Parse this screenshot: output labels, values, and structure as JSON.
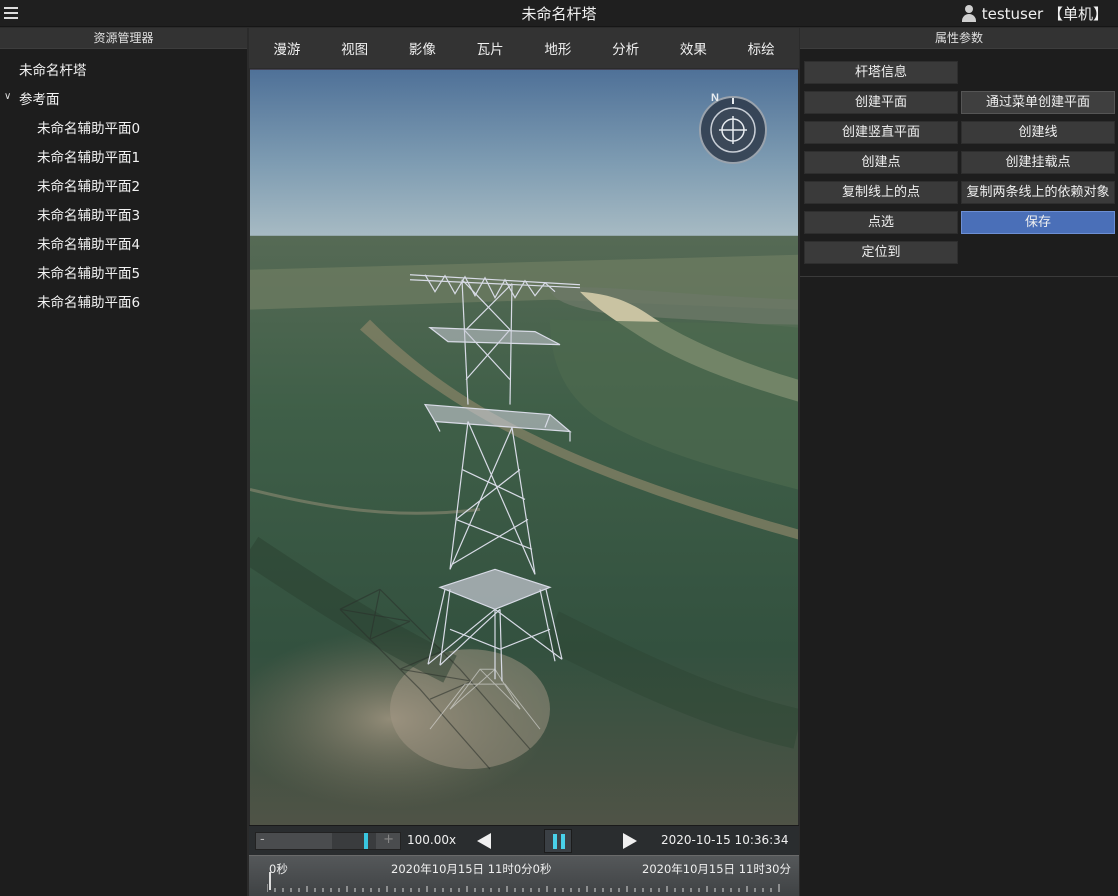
{
  "window": {
    "title": "未命名杆塔",
    "user": "testuser 【单机】"
  },
  "left_panel": {
    "header": "资源管理器",
    "root_item": "未命名杆塔",
    "group": {
      "label": "参考面",
      "expanded": true,
      "children": [
        "未命名辅助平面0",
        "未命名辅助平面1",
        "未命名辅助平面2",
        "未命名辅助平面3",
        "未命名辅助平面4",
        "未命名辅助平面5",
        "未命名辅助平面6"
      ]
    }
  },
  "toolbar": {
    "tabs": [
      "漫游",
      "视图",
      "影像",
      "瓦片",
      "地形",
      "分析",
      "效果",
      "标绘"
    ]
  },
  "compass": {
    "north_label": "N"
  },
  "animation": {
    "minus": "-",
    "plus": "+",
    "speed": "100.00x",
    "clock": "2020-10-15 10:36:34"
  },
  "timeline": {
    "start_label": "0秒",
    "mid_label": "2020年10月15日 11时0分0秒",
    "end_label": "2020年10月15日 11时30分"
  },
  "right_panel": {
    "header": "属性参数",
    "buttons": {
      "tower_info": "杆塔信息",
      "create_plane": "创建平面",
      "create_plane_menu": "通过菜单创建平面",
      "create_vertical_plane": "创建竖直平面",
      "create_line": "创建线",
      "create_point": "创建点",
      "create_mount_point": "创建挂载点",
      "copy_point_on_line": "复制线上的点",
      "copy_dependents": "复制两条线上的依赖对象",
      "pick_point": "点选",
      "save": "保存",
      "locate_to": "定位到"
    }
  },
  "colors": {
    "accent": "#4a6fb8",
    "playback_accent": "#49d1ea",
    "panel_bg": "#1d1d1d"
  }
}
